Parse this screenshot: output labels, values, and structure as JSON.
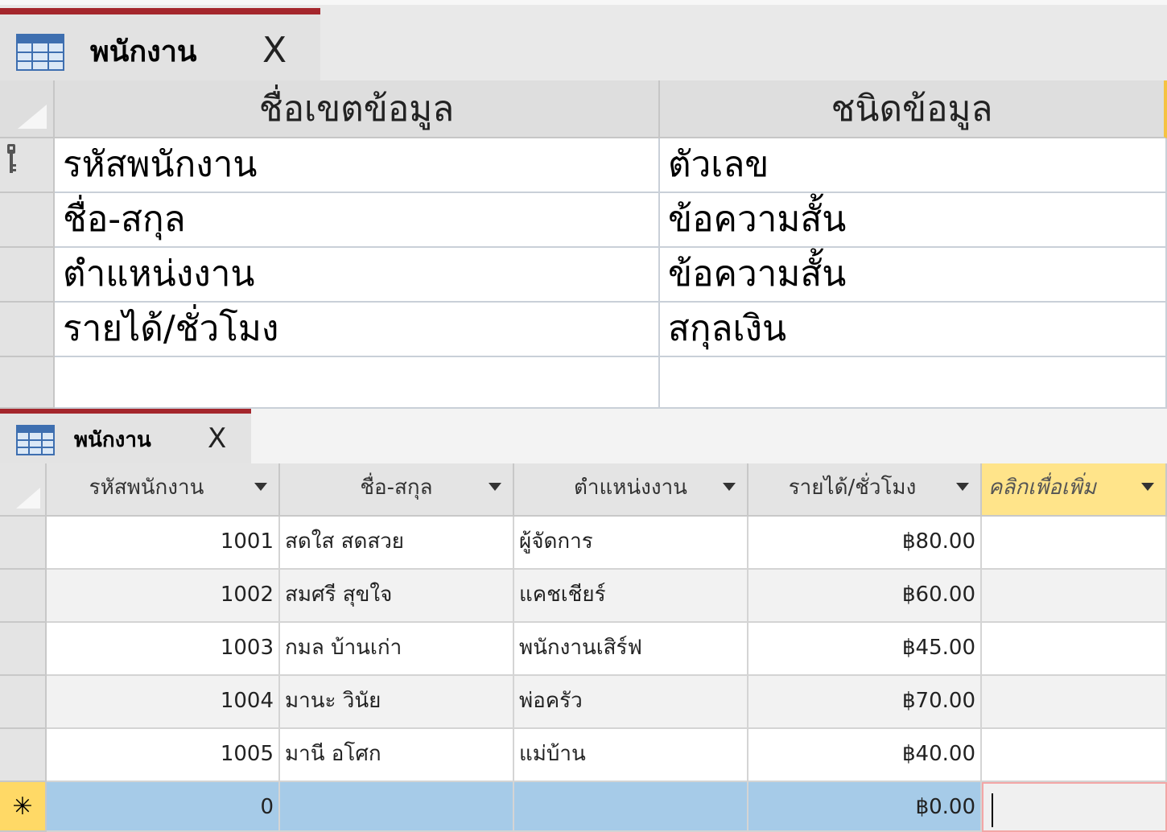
{
  "design_view": {
    "tab": {
      "label": "พนักงาน",
      "close": "X",
      "icon": "table-icon"
    },
    "columns": {
      "field_name": "ชื่อเขตข้อมูล",
      "data_type": "ชนิดข้อมูล"
    },
    "rows": [
      {
        "field": "รหัสพนักงาน",
        "type": "ตัวเลข",
        "primary_key": true
      },
      {
        "field": "ชื่อ-สกุล",
        "type": "ข้อความสั้น"
      },
      {
        "field": "ตำแหน่งงาน",
        "type": "ข้อความสั้น"
      },
      {
        "field": "รายได้/ชั่วโมง",
        "type": "สกุลเงิน"
      },
      {
        "field": "",
        "type": ""
      }
    ]
  },
  "datasheet_view": {
    "tab": {
      "label": "พนักงาน",
      "close": "X",
      "icon": "table-icon"
    },
    "columns": [
      "รหัสพนักงาน",
      "ชื่อ-สกุล",
      "ตำแหน่งงาน",
      "รายได้/ชั่วโมง",
      "คลิกเพื่อเพิ่ม"
    ],
    "rows": [
      {
        "id": "1001",
        "name": "สดใส สดสวย",
        "position": "ผู้จัดการ",
        "rate": "฿80.00"
      },
      {
        "id": "1002",
        "name": "สมศรี สุขใจ",
        "position": "แคชเชียร์",
        "rate": "฿60.00"
      },
      {
        "id": "1003",
        "name": "กมล บ้านเก่า",
        "position": "พนักงานเสิร์ฟ",
        "rate": "฿45.00"
      },
      {
        "id": "1004",
        "name": "มานะ วินัย",
        "position": "พ่อครัว",
        "rate": "฿70.00"
      },
      {
        "id": "1005",
        "name": "มานี อโศก",
        "position": "แม่บ้าน",
        "rate": "฿40.00"
      }
    ],
    "new_row": {
      "marker": "✳",
      "id": "0",
      "name": "",
      "position": "",
      "rate": "฿0.00"
    }
  },
  "colors": {
    "tab_accent": "#a4262c",
    "new_row": "#a6cbe8",
    "add_column": "#ffe48a",
    "new_row_marker": "#ffd966"
  }
}
